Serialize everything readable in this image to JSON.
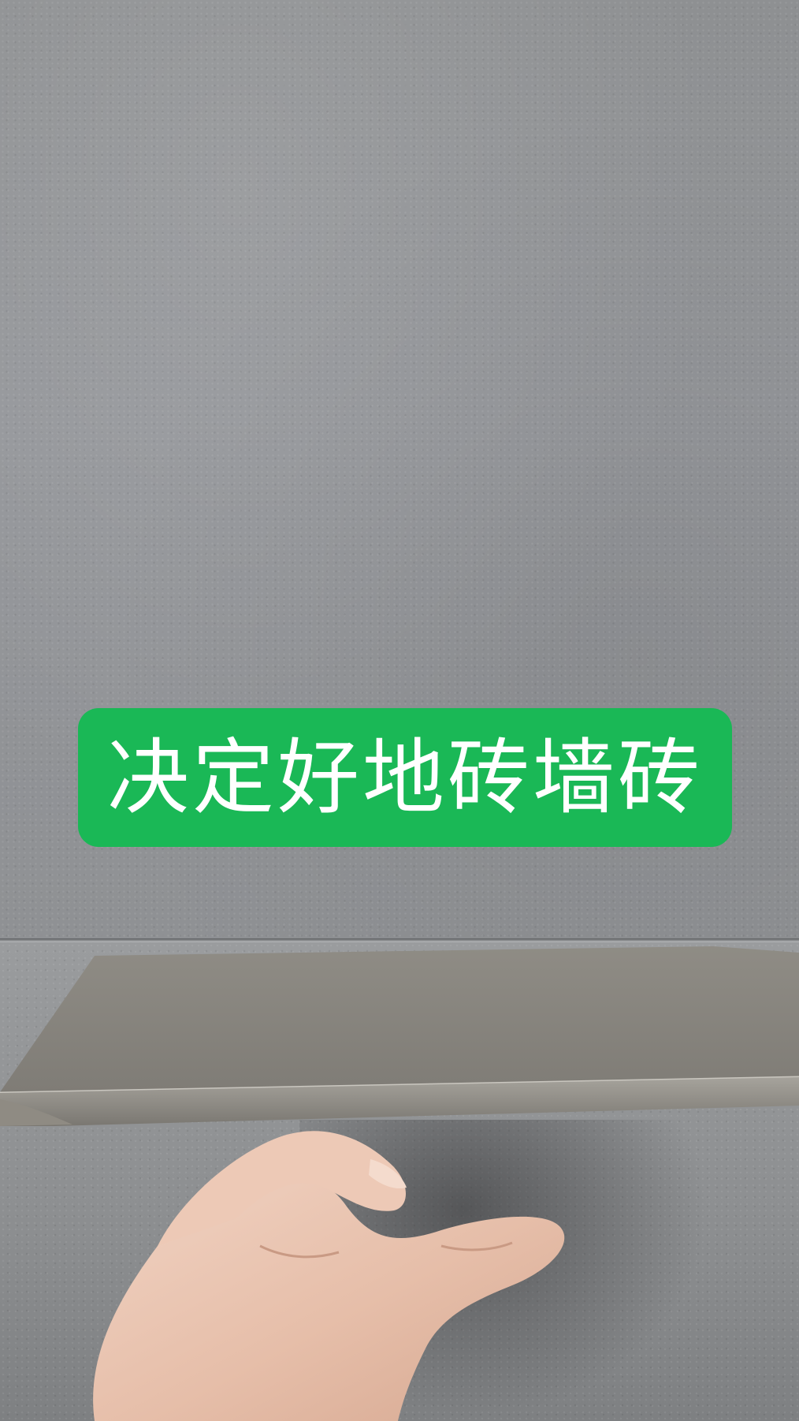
{
  "banner": {
    "text": "决定好地砖墙砖",
    "background_color": "#1ab856",
    "text_color": "#ffffff"
  },
  "scene": {
    "wall_color": "#909295",
    "tile_sample_color": "#8c8982",
    "skin_color": "#e9c4b1"
  }
}
